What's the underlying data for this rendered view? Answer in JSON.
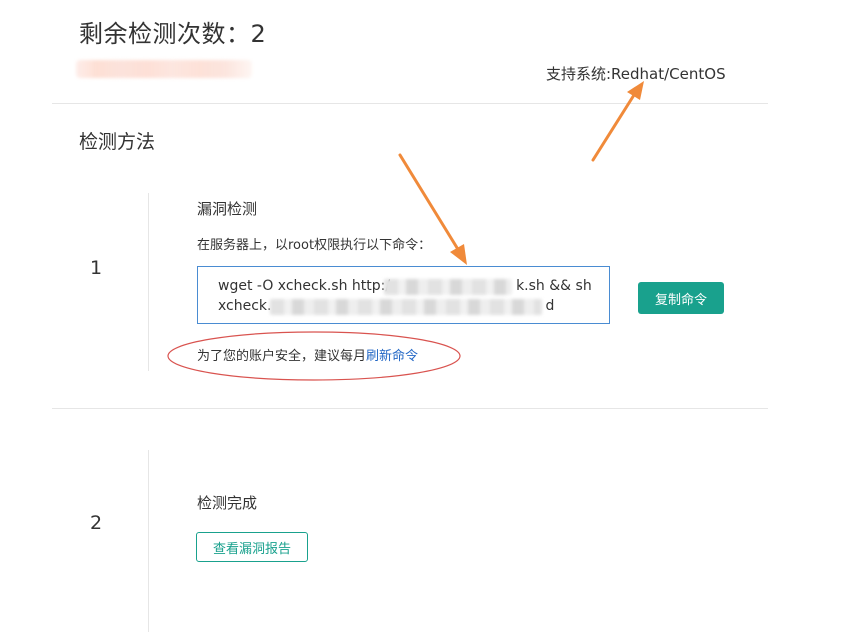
{
  "header": {
    "remaining_label": "剩余检测次数：",
    "remaining_count": "2",
    "supported_systems": "支持系统:Redhat/CentOS"
  },
  "section": {
    "title": "检测方法"
  },
  "steps": [
    {
      "number": "1",
      "title": "漏洞检测",
      "description": "在服务器上，以root权限执行以下命令：",
      "command_line1_start": "wget -O xcheck.sh http:/",
      "command_line1_end": "k.sh && sh",
      "command_line2_start": "xcheck.",
      "command_line2_end": "d",
      "copy_button": "复制命令",
      "note_text": "为了您的账户安全，建议每月",
      "note_link": "刷新命令"
    },
    {
      "number": "2",
      "title": "检测完成",
      "report_button": "查看漏洞报告"
    }
  ],
  "colors": {
    "accent": "#19a18d",
    "link": "#2267c5",
    "input_border": "#4a8cd2",
    "annotation_arrow": "#f08a3a",
    "annotation_ellipse": "#d9534f"
  }
}
